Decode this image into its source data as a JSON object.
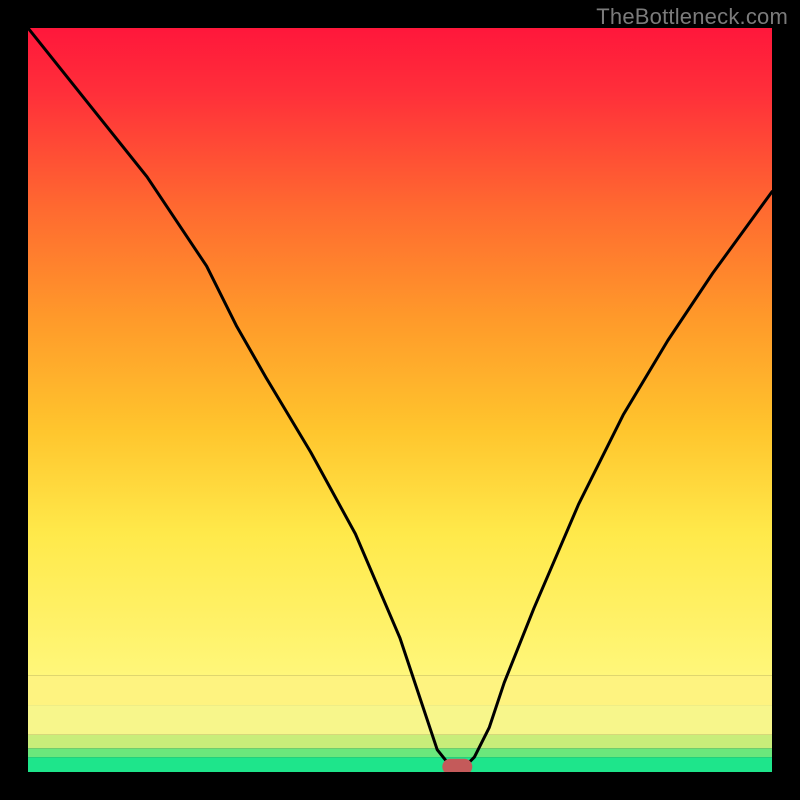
{
  "watermark": "TheBottleneck.com",
  "chart_data": {
    "type": "line",
    "title": "",
    "xlabel": "",
    "ylabel": "",
    "xlim": [
      0,
      100
    ],
    "ylim": [
      0,
      100
    ],
    "series": [
      {
        "name": "bottleneck-curve",
        "x": [
          0,
          8,
          16,
          24,
          28,
          32,
          38,
          44,
          50,
          53,
          55,
          57,
          58.5,
          60,
          62,
          64,
          68,
          74,
          80,
          86,
          92,
          100
        ],
        "values": [
          100,
          90,
          80,
          68,
          60,
          53,
          43,
          32,
          18,
          9,
          3,
          0.5,
          0.5,
          2,
          6,
          12,
          22,
          36,
          48,
          58,
          67,
          78
        ]
      }
    ],
    "annotations": [
      {
        "name": "optimum-marker",
        "x": 57.7,
        "y": 0.7,
        "shape": "pill",
        "color": "#c45a5a"
      }
    ],
    "gradient_bands": [
      {
        "y0": 0,
        "y1": 2,
        "color": "#1ee58b"
      },
      {
        "y0": 2,
        "y1": 3.2,
        "color": "#6be77c"
      },
      {
        "y0": 3.2,
        "y1": 5,
        "color": "#c8ed7a"
      },
      {
        "y0": 5,
        "y1": 9,
        "color": "#f7f68b"
      },
      {
        "y0": 9,
        "y1": 13,
        "color": "#fef380"
      },
      {
        "y0": 13,
        "y1": 100,
        "color": "gradient-red-yellow"
      }
    ]
  }
}
